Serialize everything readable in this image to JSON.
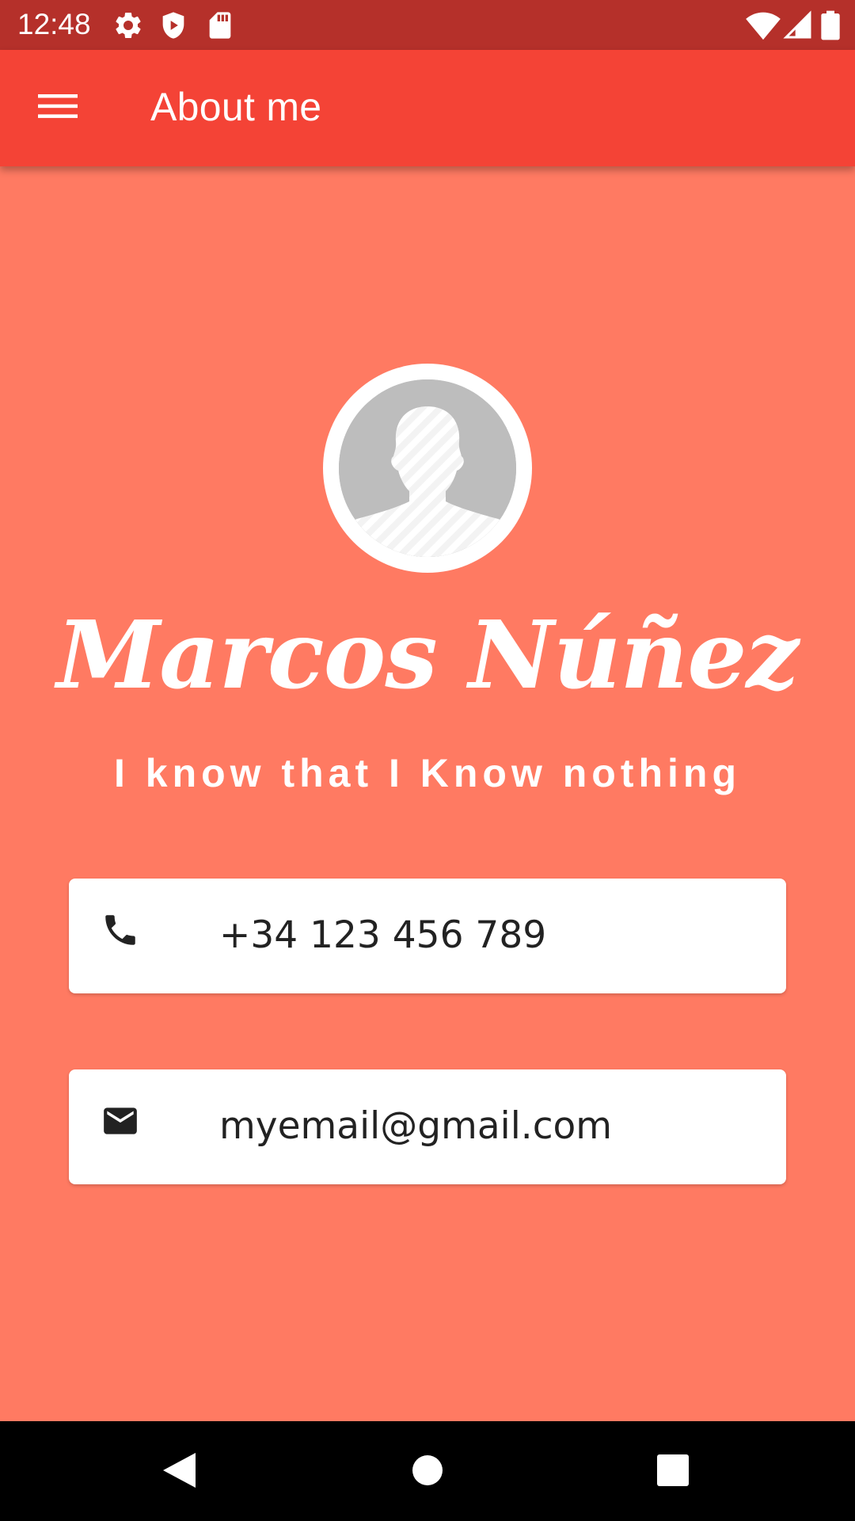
{
  "status_bar": {
    "time": "12:48",
    "left_icons": [
      "gear-icon",
      "shield-play-icon",
      "sd-card-icon"
    ],
    "right_icons": [
      "wifi-icon",
      "signal-icon",
      "battery-icon"
    ]
  },
  "app_bar": {
    "title": "About me",
    "menu_icon": "menu-icon",
    "background": "#f44336"
  },
  "profile": {
    "name": "Marcos Núñez",
    "tagline": "I know that I Know nothing",
    "avatar_icon": "person-placeholder-icon"
  },
  "contacts": {
    "phone": {
      "icon": "phone-icon",
      "value": "+34 123 456 789"
    },
    "email": {
      "icon": "mail-icon",
      "value": "myemail@gmail.com"
    }
  },
  "nav_bar": {
    "buttons": [
      "back-icon",
      "home-icon",
      "recents-icon"
    ]
  },
  "colors": {
    "status_bar": "#b5302a",
    "app_bar": "#f44336",
    "background": "#ff7a62",
    "card": "#ffffff",
    "text_on_primary": "#ffffff"
  }
}
